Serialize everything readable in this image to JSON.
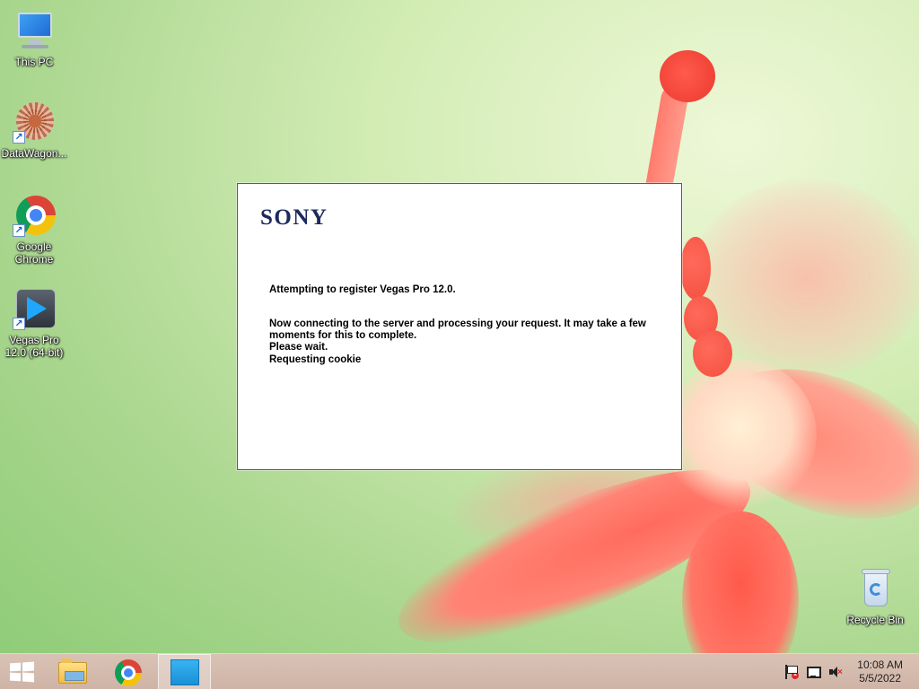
{
  "desktop": {
    "icons": [
      {
        "label": "This PC",
        "icon": "this-pc-icon"
      },
      {
        "label": "DataWagon...",
        "icon": "datawagon-icon"
      },
      {
        "label": "Google Chrome",
        "icon": "chrome-icon"
      },
      {
        "label": "Vegas Pro 12.0 (64-bit)",
        "icon": "vegas-pro-icon"
      },
      {
        "label": "Recycle Bin",
        "icon": "recycle-bin-icon"
      }
    ]
  },
  "dialog": {
    "brand": "SONY",
    "line1": "Attempting to register Vegas Pro 12.0.",
    "line2": "Now connecting to the server and processing your request. It may take a few moments for this to complete.",
    "line3": "Please wait.",
    "line4": "Requesting cookie"
  },
  "taskbar": {
    "buttons": [
      {
        "name": "start",
        "icon": "windows-logo-icon"
      },
      {
        "name": "file-explorer",
        "icon": "folder-icon"
      },
      {
        "name": "chrome",
        "icon": "chrome-icon"
      },
      {
        "name": "active-app",
        "icon": "app-window-icon"
      }
    ],
    "tray": {
      "icons": [
        "action-center-flag-icon",
        "network-icon",
        "volume-muted-icon"
      ],
      "time": "10:08 AM",
      "date": "5/5/2022"
    }
  },
  "colors": {
    "sony_brand": "#1c2a5e",
    "taskbar": "#cfb4a6"
  }
}
